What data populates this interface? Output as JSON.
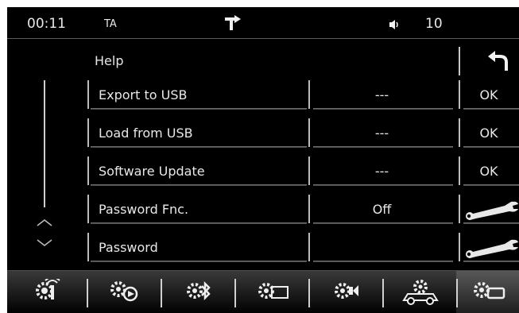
{
  "status": {
    "time": "00:11",
    "ta": "TA",
    "nav_icon": "turn-right-icon",
    "speaker_icon": "speaker-icon",
    "volume": "10"
  },
  "page": {
    "title": "Help",
    "back_icon": "back-arrow-icon"
  },
  "rows": [
    {
      "label": "Export to USB",
      "value": "---",
      "action": "OK"
    },
    {
      "label": "Load from USB",
      "value": "---",
      "action": "OK"
    },
    {
      "label": "Software Update",
      "value": "---",
      "action": "OK"
    },
    {
      "label": "Password Fnc.",
      "value": "Off",
      "action_icon": "wrench-icon"
    },
    {
      "label": "Password",
      "value": "",
      "action_icon": "wrench-icon"
    }
  ],
  "scroll": {
    "up_icon": "chevron-up-icon",
    "down_icon": "chevron-down-icon"
  },
  "bottom_nav": [
    {
      "icon": "gear-antenna-icon"
    },
    {
      "icon": "gear-play-icon"
    },
    {
      "icon": "gear-bluetooth-icon"
    },
    {
      "icon": "gear-display-icon"
    },
    {
      "icon": "gear-camera-icon"
    },
    {
      "icon": "gear-car-icon"
    },
    {
      "icon": "gear-screen-icon",
      "active": true
    }
  ]
}
